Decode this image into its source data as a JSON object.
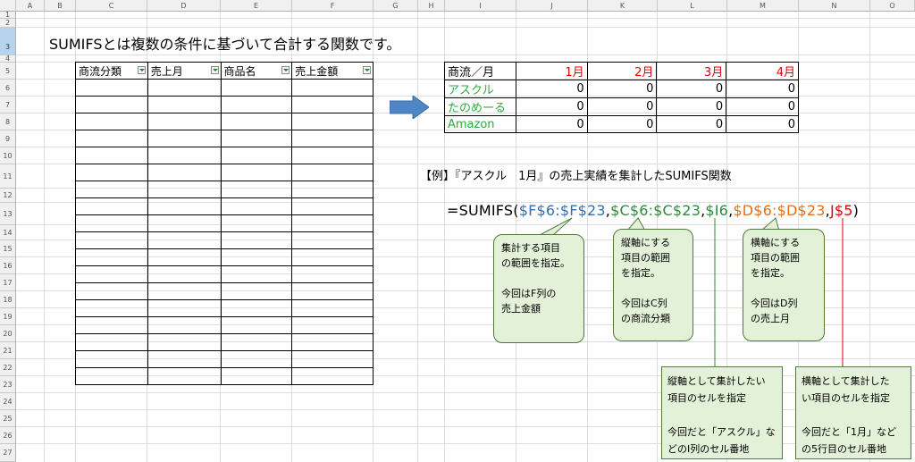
{
  "columns": [
    "",
    "A",
    "B",
    "C",
    "D",
    "E",
    "F",
    "G",
    "H",
    "I",
    "J",
    "K",
    "L",
    "M",
    "N",
    "O"
  ],
  "rows": [
    "1",
    "2",
    "3",
    "4",
    "5",
    "6",
    "7",
    "8",
    "9",
    "10",
    "11",
    "12",
    "13",
    "14",
    "15",
    "16",
    "17",
    "18",
    "19",
    "20",
    "21",
    "22",
    "23",
    "24",
    "25",
    "26",
    "27"
  ],
  "title": "SUMIFSとは複数の条件に基づいて合計する関数です。",
  "data_table": {
    "headers": [
      "商流分類",
      "売上月",
      "商品名",
      "売上金額"
    ]
  },
  "summary_table": {
    "corner": "商流／月",
    "months": [
      "1月",
      "2月",
      "3月",
      "4月"
    ],
    "rows": [
      {
        "label": "アスクル",
        "values": [
          "0",
          "0",
          "0",
          "0"
        ]
      },
      {
        "label": "たのめーる",
        "values": [
          "0",
          "0",
          "0",
          "0"
        ]
      },
      {
        "label": "Amazon",
        "values": [
          "0",
          "0",
          "0",
          "0"
        ]
      }
    ]
  },
  "example_heading": "【例】『アスクル　1月』の売上実績を集計したSUMIFS関数",
  "formula": {
    "prefix": "=SUMIFS(",
    "arg1": "$F$6:$F$23",
    "c1": ",",
    "arg2": "$C$6:$C$23",
    "c2": ",",
    "arg3": "$I6",
    "c3": ",",
    "arg4": "$D$6:$D$23",
    "c4": ",",
    "arg5": "J$5",
    "suffix": ")"
  },
  "callouts": {
    "sum_range": "集計する項目\nの範囲を指定。\n\n今回はF列の\n売上金額",
    "criteria_range1": "縦軸にする\n項目の範囲\nを指定。\n\n今回はC列\nの商流分類",
    "criteria_range2": "横軸にする\n項目の範囲\nを指定。\n\n今回はD列\nの売上月"
  },
  "notes": {
    "criteria1": "縦軸として集計したい\n項目のセルを指定\n\n今回だと「アスクル」な\nどのI列のセル番地",
    "criteria2": "横軸として集計した\nい項目のセルを指定\n\n今回だと「1月」など\nの5行目のセル番地"
  },
  "colors": {
    "arg_blue": "#2f6fb5",
    "arg_green": "#2e8b3a",
    "arg_orange": "#e0701a",
    "arg_red": "#e00000",
    "callout_fill": "#e4f1d9",
    "arrow": "#4f86c6"
  },
  "icons": [
    "filter-dropdown-icon",
    "right-arrow-icon"
  ]
}
